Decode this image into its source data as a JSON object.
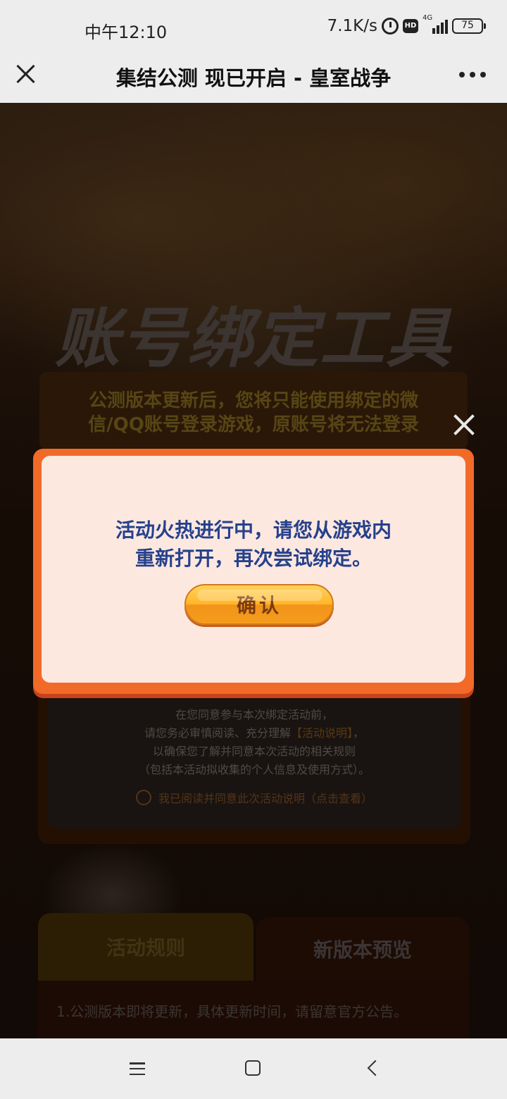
{
  "status_bar": {
    "time": "中午12:10",
    "net_speed": "7.1K/s",
    "hd_label": "HD",
    "network_type": "4G",
    "battery": "75"
  },
  "title_bar": {
    "title": "集结公测 现已开启 - 皇室战争"
  },
  "background_page": {
    "banner_title": "账号绑定工具",
    "notice_line1": "公测版本更新后，您将只能使用绑定的微",
    "notice_line2": "信/QQ账号登录游戏，原账号将无法登录",
    "agreement_line1": "在您同意参与本次绑定活动前，",
    "agreement_line2_prefix": "请您务必审慎阅读、充分理解",
    "agreement_line2_link": "【活动说明】",
    "agreement_line2_suffix": "，",
    "agreement_line3": "以确保您了解并同意本次活动的相关规则",
    "agreement_line4": "（包括本活动拟收集的个人信息及使用方式）。",
    "agree_checkbox_label": "我已阅读并同意此次活动说明（点击查看）",
    "tabs": [
      {
        "label": "活动规则"
      },
      {
        "label": "新版本预览"
      }
    ],
    "rules_text": "1.公测版本即将更新，具体更新时间，请留意官方公告。"
  },
  "modal": {
    "message_line1": "活动火热进行中，请您从游戏内",
    "message_line2": "重新打开，再次尝试绑定。",
    "confirm_label": "确认"
  }
}
